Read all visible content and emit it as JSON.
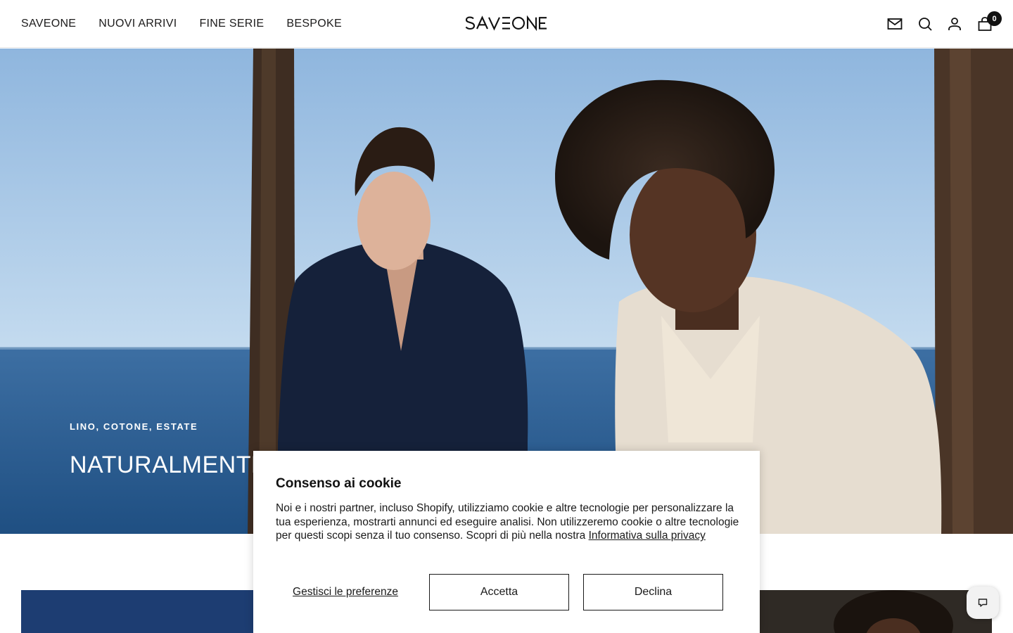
{
  "header": {
    "nav": [
      "SAVEONE",
      "NUOVI ARRIVI",
      "FINE SERIE",
      "BESPOKE"
    ],
    "logo_text": "SAVEONE",
    "icons": [
      "mail-icon",
      "search-icon",
      "account-icon",
      "cart-icon"
    ],
    "cart_count": "0"
  },
  "hero": {
    "kicker": "LINO, COTONE, ESTATE",
    "title": "NATURALMENTE"
  },
  "cookie_banner": {
    "title": "Consenso ai cookie",
    "body": "Noi e i nostri partner, incluso Shopify, utilizziamo cookie e altre tecnologie per personalizzare la tua esperienza, mostrarti annunci ed eseguire analisi. Non utilizzeremo cookie o altre tecnologie per questi scopi senza il tuo consenso. Scopri di più nella nostra",
    "privacy_link": "Informativa sulla privacy",
    "manage_label": "Gestisci le preferenze",
    "accept_label": "Accetta",
    "decline_label": "Declina"
  },
  "chat": {
    "icon": "chat-icon"
  },
  "colors": {
    "text": "#1c1b1b",
    "badge": "#111111",
    "sky": "#a9c9e6",
    "sea": "#2a5f95",
    "tile_navy": "#1d3d72"
  }
}
